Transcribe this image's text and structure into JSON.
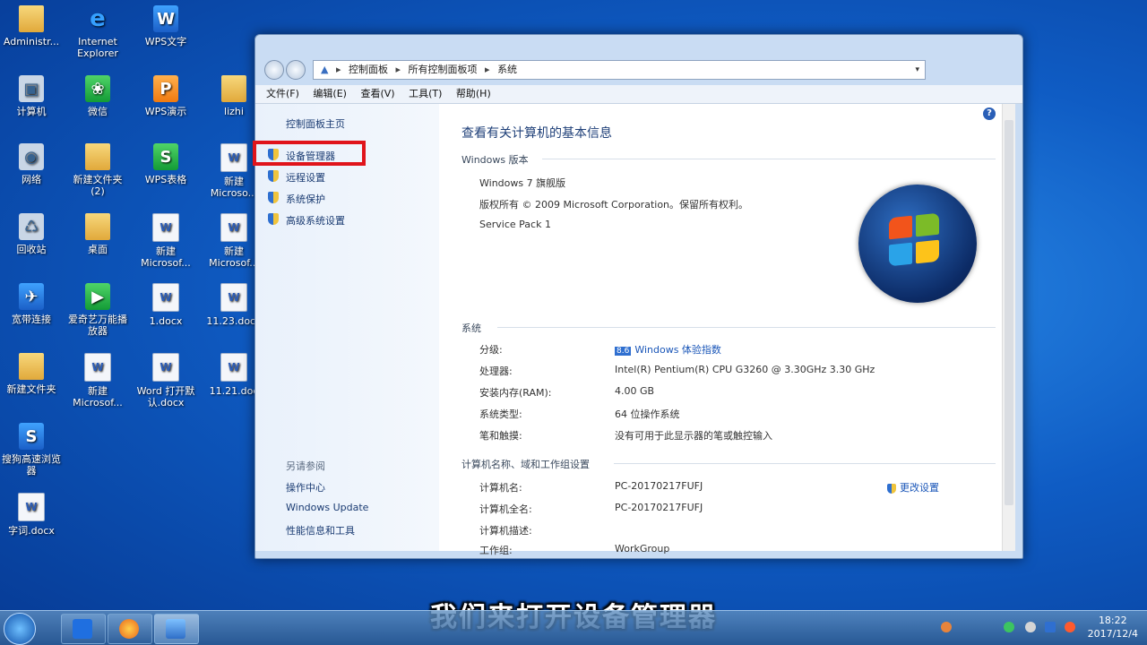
{
  "desktop": {
    "icons": [
      {
        "label": "Administr...",
        "glyph": "📁"
      },
      {
        "label": "Internet Explorer",
        "glyph": "e"
      },
      {
        "label": "WPS文字",
        "glyph": "W"
      },
      {
        "label": "计算机",
        "glyph": "▣"
      },
      {
        "label": "微信",
        "glyph": "❀"
      },
      {
        "label": "WPS演示",
        "glyph": "P"
      },
      {
        "label": "lizhi",
        "glyph": ""
      },
      {
        "label": "网络",
        "glyph": "◉"
      },
      {
        "label": "新建文件夹 (2)",
        "glyph": ""
      },
      {
        "label": "WPS表格",
        "glyph": "S"
      },
      {
        "label": "新建 Microso...",
        "glyph": "W"
      },
      {
        "label": "回收站",
        "glyph": "♺"
      },
      {
        "label": "桌面",
        "glyph": ""
      },
      {
        "label": "新建 Microsof...",
        "glyph": "W"
      },
      {
        "label": "新建 Microsof...",
        "glyph": "W"
      },
      {
        "label": "宽带连接",
        "glyph": "✈"
      },
      {
        "label": "爱奇艺万能播放器",
        "glyph": "▶"
      },
      {
        "label": "1.docx",
        "glyph": "W"
      },
      {
        "label": "11.23.docx",
        "glyph": "W"
      },
      {
        "label": "新建文件夹",
        "glyph": ""
      },
      {
        "label": "新建 Microsof...",
        "glyph": "W"
      },
      {
        "label": "Word 打开默认.docx",
        "glyph": "W"
      },
      {
        "label": "11.21.doc",
        "glyph": "W"
      },
      {
        "label": "搜狗高速浏览器",
        "glyph": "S"
      },
      {
        "label": "字词.docx",
        "glyph": "W"
      }
    ]
  },
  "window": {
    "nav": {
      "back": "←",
      "forward": "→"
    },
    "address": {
      "crumbs": [
        "控制面板",
        "所有控制面板项",
        "系统"
      ],
      "dropdown": "▾"
    },
    "menu": [
      "文件(F)",
      "编辑(E)",
      "查看(V)",
      "工具(T)",
      "帮助(H)"
    ],
    "left": {
      "home": "控制面板主页",
      "links": [
        "设备管理器",
        "远程设置",
        "系统保护",
        "高级系统设置"
      ],
      "see_also": "另请参阅",
      "see_also_links": [
        "操作中心",
        "Windows Update",
        "性能信息和工具"
      ]
    },
    "main": {
      "help": "?",
      "title": "查看有关计算机的基本信息",
      "edition_heading": "Windows 版本",
      "edition": "Windows 7 旗舰版",
      "copyright": "版权所有 © 2009 Microsoft Corporation。保留所有权利。",
      "service_pack": "Service Pack 1",
      "system_heading": "系统",
      "system_rows": [
        {
          "label": "分级:",
          "value": "Windows 体验指数",
          "badge": "8.6"
        },
        {
          "label": "处理器:",
          "value": "Intel(R) Pentium(R) CPU G3260 @ 3.30GHz   3.30 GHz"
        },
        {
          "label": "安装内存(RAM):",
          "value": "4.00 GB"
        },
        {
          "label": "系统类型:",
          "value": "64 位操作系统"
        },
        {
          "label": "笔和触摸:",
          "value": "没有可用于此显示器的笔或触控输入"
        }
      ],
      "computer_heading": "计算机名称、域和工作组设置",
      "computer_rows": [
        {
          "label": "计算机名:",
          "value": "PC-20170217FUFJ"
        },
        {
          "label": "计算机全名:",
          "value": "PC-20170217FUFJ"
        },
        {
          "label": "计算机描述:",
          "value": ""
        },
        {
          "label": "工作组:",
          "value": "WorkGroup"
        }
      ],
      "change_settings": "更改设置"
    }
  },
  "caption": "我们来打开设备管理器",
  "taskbar": {
    "clock_time": "18:22",
    "clock_date": "2017/12/4"
  },
  "colors": {
    "highlight": "#e0141b",
    "link": "#1a56b8",
    "title": "#1e3f78"
  }
}
